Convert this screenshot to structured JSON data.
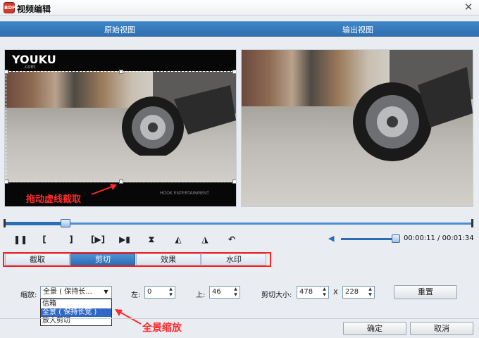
{
  "window": {
    "title": "视频编辑",
    "close_glyph": "✕",
    "logo_text": "BDP"
  },
  "views": {
    "original": "原始视图",
    "output": "输出视图"
  },
  "watermark": {
    "logo": "YOUKU",
    "logo_sub": ".com",
    "bottom": "HOOK ENTERTAINMENT"
  },
  "annotations": {
    "drag_hint": "拖动虚线截取",
    "fit_hint": "全景缩放",
    "hint_color": "#ff2a2a"
  },
  "playback": {
    "progress_fraction": 0.13,
    "volume_fraction": 1.0,
    "time_current": "00:00:11",
    "time_total": "00:01:34",
    "buttons": [
      {
        "name": "pause-button",
        "glyph": "❚❚"
      },
      {
        "name": "mark-in-button",
        "glyph": "["
      },
      {
        "name": "mark-out-button",
        "glyph": "]"
      },
      {
        "name": "play-segment-button",
        "glyph": "[▶]"
      },
      {
        "name": "next-frame-button",
        "glyph": "▶▮"
      },
      {
        "name": "split-button",
        "glyph": "⧗"
      },
      {
        "name": "rotate-left-button",
        "glyph": "◭"
      },
      {
        "name": "rotate-right-button",
        "glyph": "◮"
      },
      {
        "name": "undo-button",
        "glyph": "↶"
      }
    ]
  },
  "tabs": [
    {
      "label": "截取",
      "active": false
    },
    {
      "label": "剪切",
      "active": true
    },
    {
      "label": "效果",
      "active": false
    },
    {
      "label": "水印",
      "active": false
    }
  ],
  "settings": {
    "zoom_label": "缩放:",
    "zoom_selected": "全景 ( 保持长...",
    "zoom_options": [
      "信箱",
      "全景 ( 保持长宽 )",
      "放大剪切"
    ],
    "zoom_highlighted_index": 1,
    "left_label": "左:",
    "left_value": "0",
    "top_label": "上:",
    "top_value": "46",
    "crop_size_label": "剪切大小:",
    "crop_width": "478",
    "crop_x": "X",
    "crop_height": "228",
    "reset_label": "重置"
  },
  "footer": {
    "ok_label": "确定",
    "cancel_label": "取消"
  },
  "colors": {
    "accent": "#2f6fb0",
    "active_tab": "#2c6db3",
    "highlight_border": "#ff2020"
  }
}
